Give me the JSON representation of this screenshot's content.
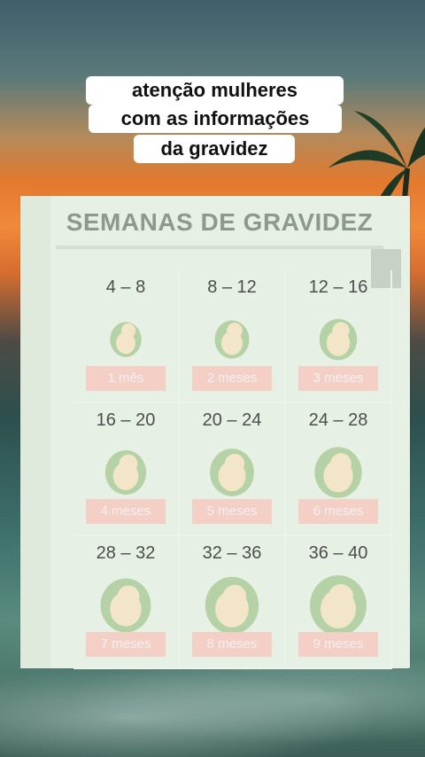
{
  "caption": {
    "line1": "atenção mulheres",
    "line2": "com as informações",
    "line3": "da gravidez"
  },
  "card": {
    "title": "SEMANAS DE GRAVIDEZ",
    "stages": [
      {
        "weeks": "4 – 8",
        "months": "1 mês"
      },
      {
        "weeks": "8 – 12",
        "months": "2 meses"
      },
      {
        "weeks": "12 – 16",
        "months": "3 meses"
      },
      {
        "weeks": "16 – 20",
        "months": "4 meses"
      },
      {
        "weeks": "20 – 24",
        "months": "5 meses"
      },
      {
        "weeks": "24 – 28",
        "months": "6 meses"
      },
      {
        "weeks": "28 – 32",
        "months": "7 meses"
      },
      {
        "weeks": "32 – 36",
        "months": "8 meses"
      },
      {
        "weeks": "36 – 40",
        "months": "9 meses"
      }
    ]
  },
  "colors": {
    "card_bg": "#e7f0e4",
    "title_text": "#8c9a8c",
    "month_badge": "#f4cfc6",
    "fetus_fill": "#f3e6c8",
    "fetus_sac": "#9ec48a"
  },
  "icons": [
    "palm-tree-icon",
    "fetus-icon"
  ]
}
